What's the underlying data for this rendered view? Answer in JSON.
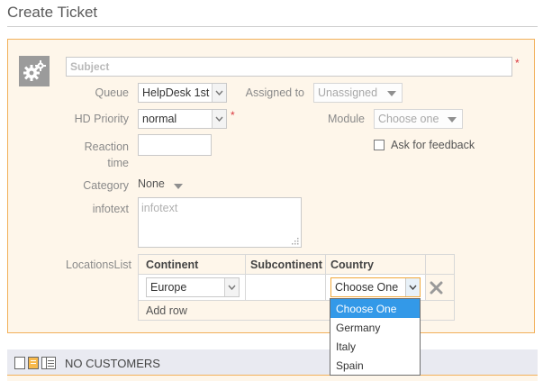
{
  "page": {
    "title": "Create Ticket"
  },
  "form": {
    "subject": {
      "placeholder": "Subject",
      "required_mark": "*"
    },
    "queue": {
      "label": "Queue",
      "value": "HelpDesk 1st"
    },
    "assigned_to": {
      "label": "Assigned to",
      "value": "Unassigned"
    },
    "hd_priority": {
      "label": "HD Priority",
      "value": "normal",
      "required_mark": "*"
    },
    "module": {
      "label": "Module",
      "value": "Choose one"
    },
    "reaction_time": {
      "label_line1": "Reaction",
      "label_line2": "time",
      "value": ""
    },
    "ask_feedback": {
      "label": "Ask for feedback",
      "checked": false
    },
    "category": {
      "label": "Category",
      "value": "None"
    },
    "infotext": {
      "label": "infotext",
      "placeholder": "infotext"
    }
  },
  "locations": {
    "label": "LocationsList",
    "columns": [
      "Continent",
      "Subcontinent",
      "Country"
    ],
    "row": {
      "continent": "Europe",
      "subcontinent": "",
      "country": "Choose One"
    },
    "add_row_label": "Add row",
    "dropdown_options": [
      "Choose One",
      "Germany",
      "Italy",
      "Spain"
    ],
    "dropdown_selected": "Choose One"
  },
  "customers": {
    "title": "NO CUSTOMERS"
  },
  "icons": {
    "ticket_type": "gear-icon",
    "remove_row": "close-icon",
    "view_icons": [
      "list-view-icon",
      "card-view-icon",
      "detail-view-icon"
    ]
  },
  "colors": {
    "panel_border": "#f2b05a",
    "panel_bg": "#fef6ea",
    "selected_option": "#3399e8",
    "required": "#d9363e"
  }
}
